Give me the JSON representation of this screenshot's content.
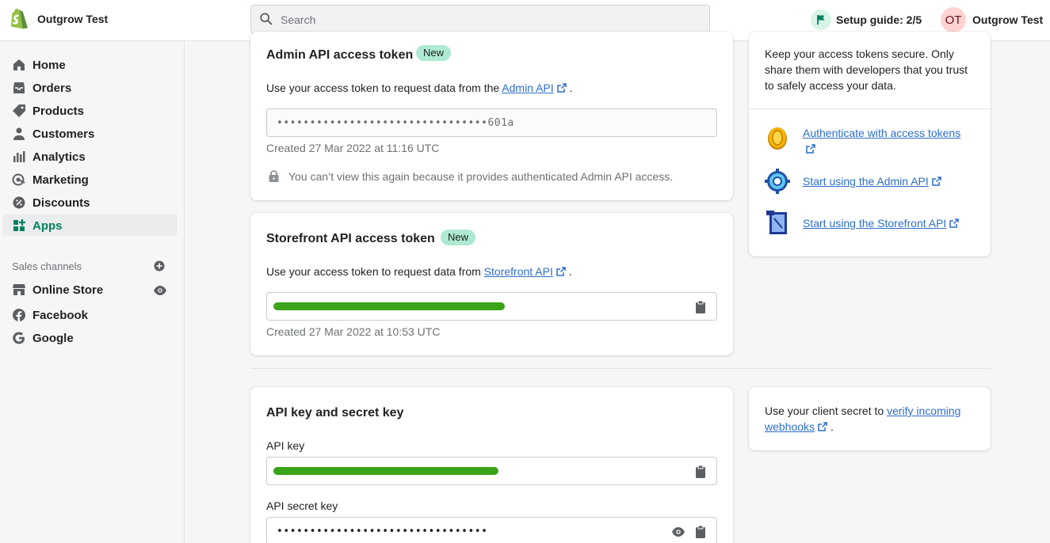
{
  "topbar": {
    "store_name": "Outgrow Test",
    "search_placeholder": "Search",
    "setup_guide": "Setup guide: 2/5",
    "avatar_initials": "OT",
    "user_name": "Outgrow Test"
  },
  "sidebar": {
    "items": [
      {
        "label": "Home",
        "icon": "home-icon"
      },
      {
        "label": "Orders",
        "icon": "orders-icon"
      },
      {
        "label": "Products",
        "icon": "tag-icon"
      },
      {
        "label": "Customers",
        "icon": "person-icon"
      },
      {
        "label": "Analytics",
        "icon": "bar-chart-icon"
      },
      {
        "label": "Marketing",
        "icon": "target-icon"
      },
      {
        "label": "Discounts",
        "icon": "discount-icon"
      },
      {
        "label": "Apps",
        "icon": "apps-icon"
      }
    ],
    "sales_channels_label": "Sales channels",
    "channels": [
      {
        "label": "Online Store",
        "icon": "store-icon"
      },
      {
        "label": "Facebook",
        "icon": "facebook-icon"
      },
      {
        "label": "Google",
        "icon": "google-icon"
      }
    ]
  },
  "admin_token": {
    "title": "Admin API access token",
    "badge": "New",
    "desc_prefix": "Use your access token to request data from the ",
    "desc_link": "Admin API",
    "desc_suffix": ".",
    "value": "••••••••••••••••••••••••••••••••601a",
    "created": "Created 27 Mar 2022 at 11:16 UTC",
    "warning": "You can’t view this again because it provides authenticated Admin API access."
  },
  "storefront_token": {
    "title": "Storefront API access token",
    "badge": "New",
    "desc_prefix": "Use your access token to request data from ",
    "desc_link": "Storefront API",
    "desc_suffix": ".",
    "created": "Created 27 Mar 2022 at 10:53 UTC"
  },
  "security_card": {
    "text": "Keep your access tokens secure. Only share them with developers that you trust to safely access your data.",
    "links": [
      {
        "label": "Authenticate with access tokens",
        "icon": "coin-icon"
      },
      {
        "label": "Start using the Admin API",
        "icon": "gear-icon"
      },
      {
        "label": "Start using the Storefront API",
        "icon": "document-icon"
      }
    ]
  },
  "api_keys": {
    "title": "API key and secret key",
    "api_key_label": "API key",
    "api_secret_label": "API secret key",
    "secret_value": "••••••••••••••••••••••••••••••••"
  },
  "webhook_card": {
    "prefix": "Use your client secret to ",
    "link": "verify incoming webhooks",
    "suffix": "."
  },
  "colors": {
    "accent": "#008060",
    "link": "#2c6ecb",
    "badge": "#aee9d1",
    "redaction": "#3aa317"
  }
}
